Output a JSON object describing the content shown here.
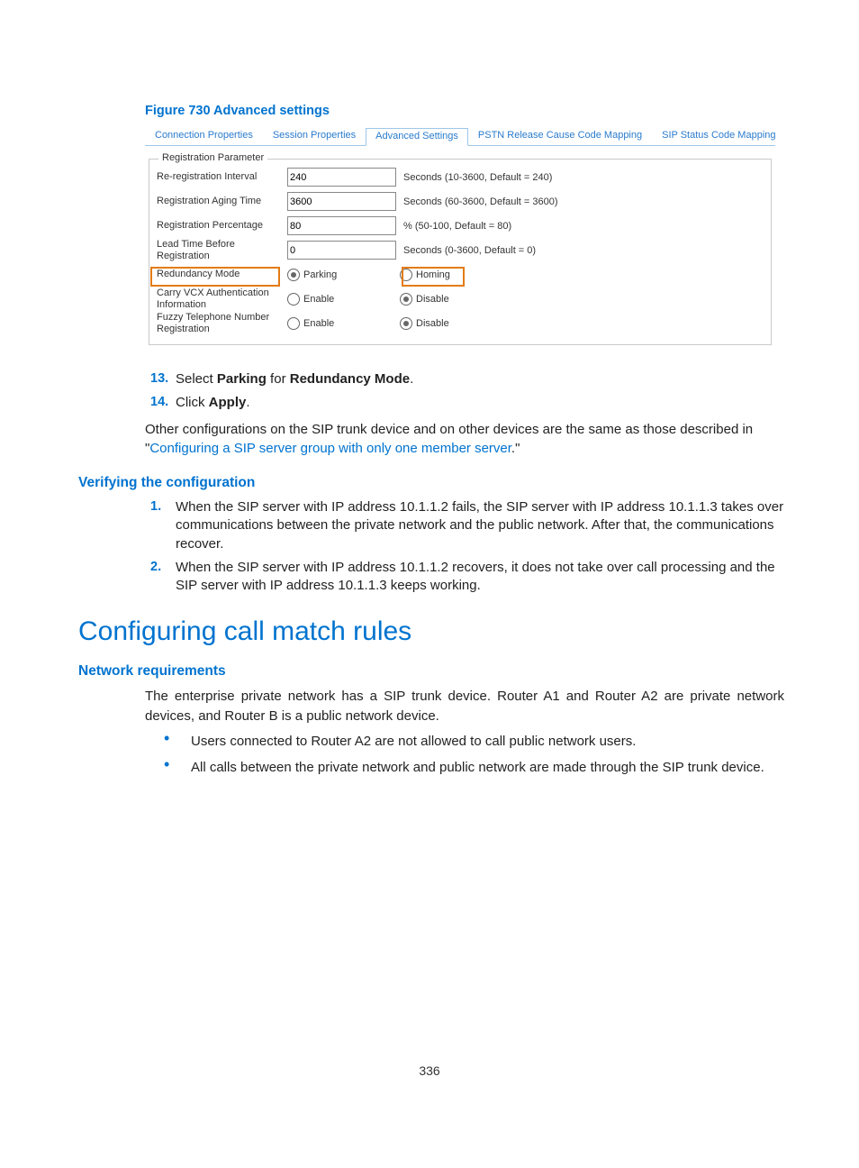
{
  "figure_caption": "Figure 730 Advanced settings",
  "tabs": {
    "t0": "Connection Properties",
    "t1": "Session Properties",
    "t2": "Advanced Settings",
    "t3": "PSTN Release Cause Code Mapping",
    "t4": "SIP Status Code Mapping"
  },
  "panel": {
    "fieldset_title": "Registration Parameter",
    "row_rereg": {
      "label": "Re-registration Interval",
      "value": "240",
      "hint": "Seconds (10-3600, Default = 240)"
    },
    "row_aging": {
      "label": "Registration Aging Time",
      "value": "3600",
      "hint": "Seconds (60-3600, Default = 3600)"
    },
    "row_pct": {
      "label": "Registration Percentage",
      "value": "80",
      "hint": "% (50-100, Default = 80)"
    },
    "row_lead": {
      "label": "Lead Time Before Registration",
      "value": "0",
      "hint": "Seconds (0-3600, Default = 0)"
    },
    "row_redund": {
      "label": "Redundancy Mode",
      "opt1": "Parking",
      "opt2": "Homing",
      "selected": "opt1"
    },
    "row_vcx": {
      "label": "Carry VCX Authentication Information",
      "opt1": "Enable",
      "opt2": "Disable",
      "selected": "opt2"
    },
    "row_fuzzy": {
      "label": "Fuzzy Telephone Number Registration",
      "opt1": "Enable",
      "opt2": "Disable",
      "selected": "opt2"
    }
  },
  "steps_a": {
    "n13": "13.",
    "t13_pre": "Select ",
    "t13_bold1": "Parking",
    "t13_mid": " for ",
    "t13_bold2": "Redundancy Mode",
    "t13_end": ".",
    "n14": "14.",
    "t14_pre": "Click ",
    "t14_bold": "Apply",
    "t14_end": "."
  },
  "para_other_pre": "Other configurations on the SIP trunk device and on other devices are the same as those described in \"",
  "para_other_link": "Configuring a SIP server group with only one member server",
  "para_other_post": ".\"",
  "h_verify": "Verifying the configuration",
  "verify_steps": {
    "n1": "1.",
    "t1": "When the SIP server with IP address 10.1.1.2 fails, the SIP server with IP address 10.1.1.3 takes over communications between the private network and the public network. After that, the communications recover.",
    "n2": "2.",
    "t2": "When the SIP server with IP address 10.1.1.2 recovers, it does not take over call processing and the SIP server with IP address 10.1.1.3 keeps working."
  },
  "h_config": "Configuring call match rules",
  "h_netreq": "Network requirements",
  "para_netreq": "The enterprise private network has a SIP trunk device. Router A1 and Router A2 are private network devices, and Router B is a public network device.",
  "bullets": {
    "b1": "Users connected to Router A2 are not allowed to call public network users.",
    "b2": "All calls between the private network and public network are made through the SIP trunk device."
  },
  "page_number": "336"
}
